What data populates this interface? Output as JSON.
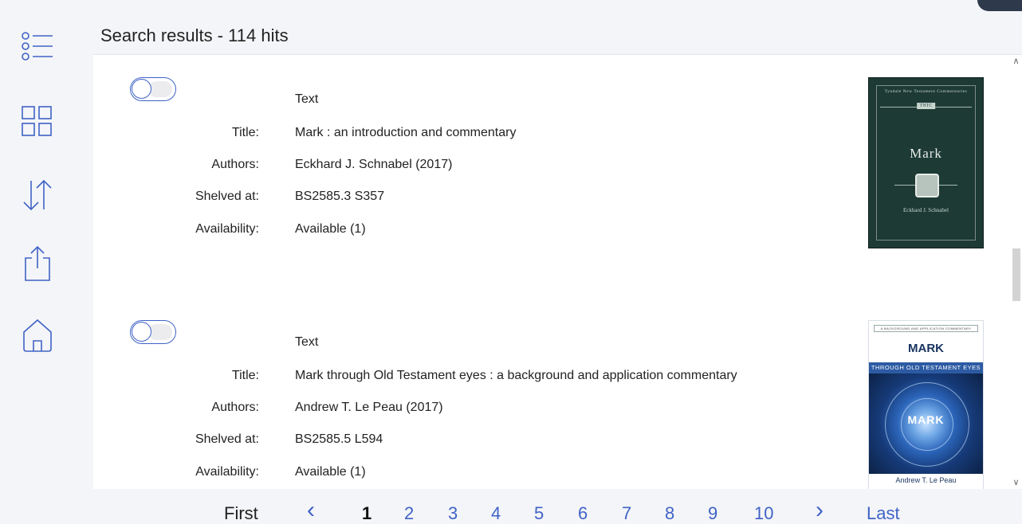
{
  "header": {
    "title": "Search results - 114 hits"
  },
  "rail": {
    "items": [
      {
        "icon": "list-icon"
      },
      {
        "icon": "grid-icon"
      },
      {
        "icon": "sort-icon"
      },
      {
        "icon": "share-icon"
      },
      {
        "icon": "home-icon"
      }
    ]
  },
  "labels": {
    "title": "Title:",
    "authors": "Authors:",
    "shelved": "Shelved at:",
    "availability": "Availability:"
  },
  "results": [
    {
      "type": "Text",
      "title": "Mark : an introduction and commentary",
      "authors": "Eckhard J. Schnabel (2017)",
      "shelved": "BS2585.3 S357",
      "availability": "Available (1)",
      "cover": {
        "series": "Tyndale New Testament Commentaries",
        "badge": "TNTC",
        "title": "Mark",
        "author": "Eckhard J. Schnabel"
      }
    },
    {
      "type": "Text",
      "title": "Mark through Old Testament eyes : a background and application commentary",
      "authors": "Andrew T. Le Peau (2017)",
      "shelved": "BS2585.5 L594",
      "availability": "Available (1)",
      "cover": {
        "series": "A BACKGROUND AND APPLICATION COMMENTARY",
        "title": "MARK",
        "subtitle": "THROUGH OLD TESTAMENT EYES",
        "art_title": "MARK",
        "author": "Andrew T. Le Peau"
      }
    }
  ],
  "pagination": {
    "first": "First",
    "last": "Last",
    "pages": [
      "1",
      "2",
      "3",
      "4",
      "5",
      "6",
      "7",
      "8",
      "9",
      "10"
    ],
    "current": "1",
    "prev_icon": "chevron-left-icon",
    "next_icon": "chevron-right-icon"
  },
  "colors": {
    "accent": "#3f63c6",
    "background": "#f4f5f8",
    "panel": "#ffffff"
  }
}
